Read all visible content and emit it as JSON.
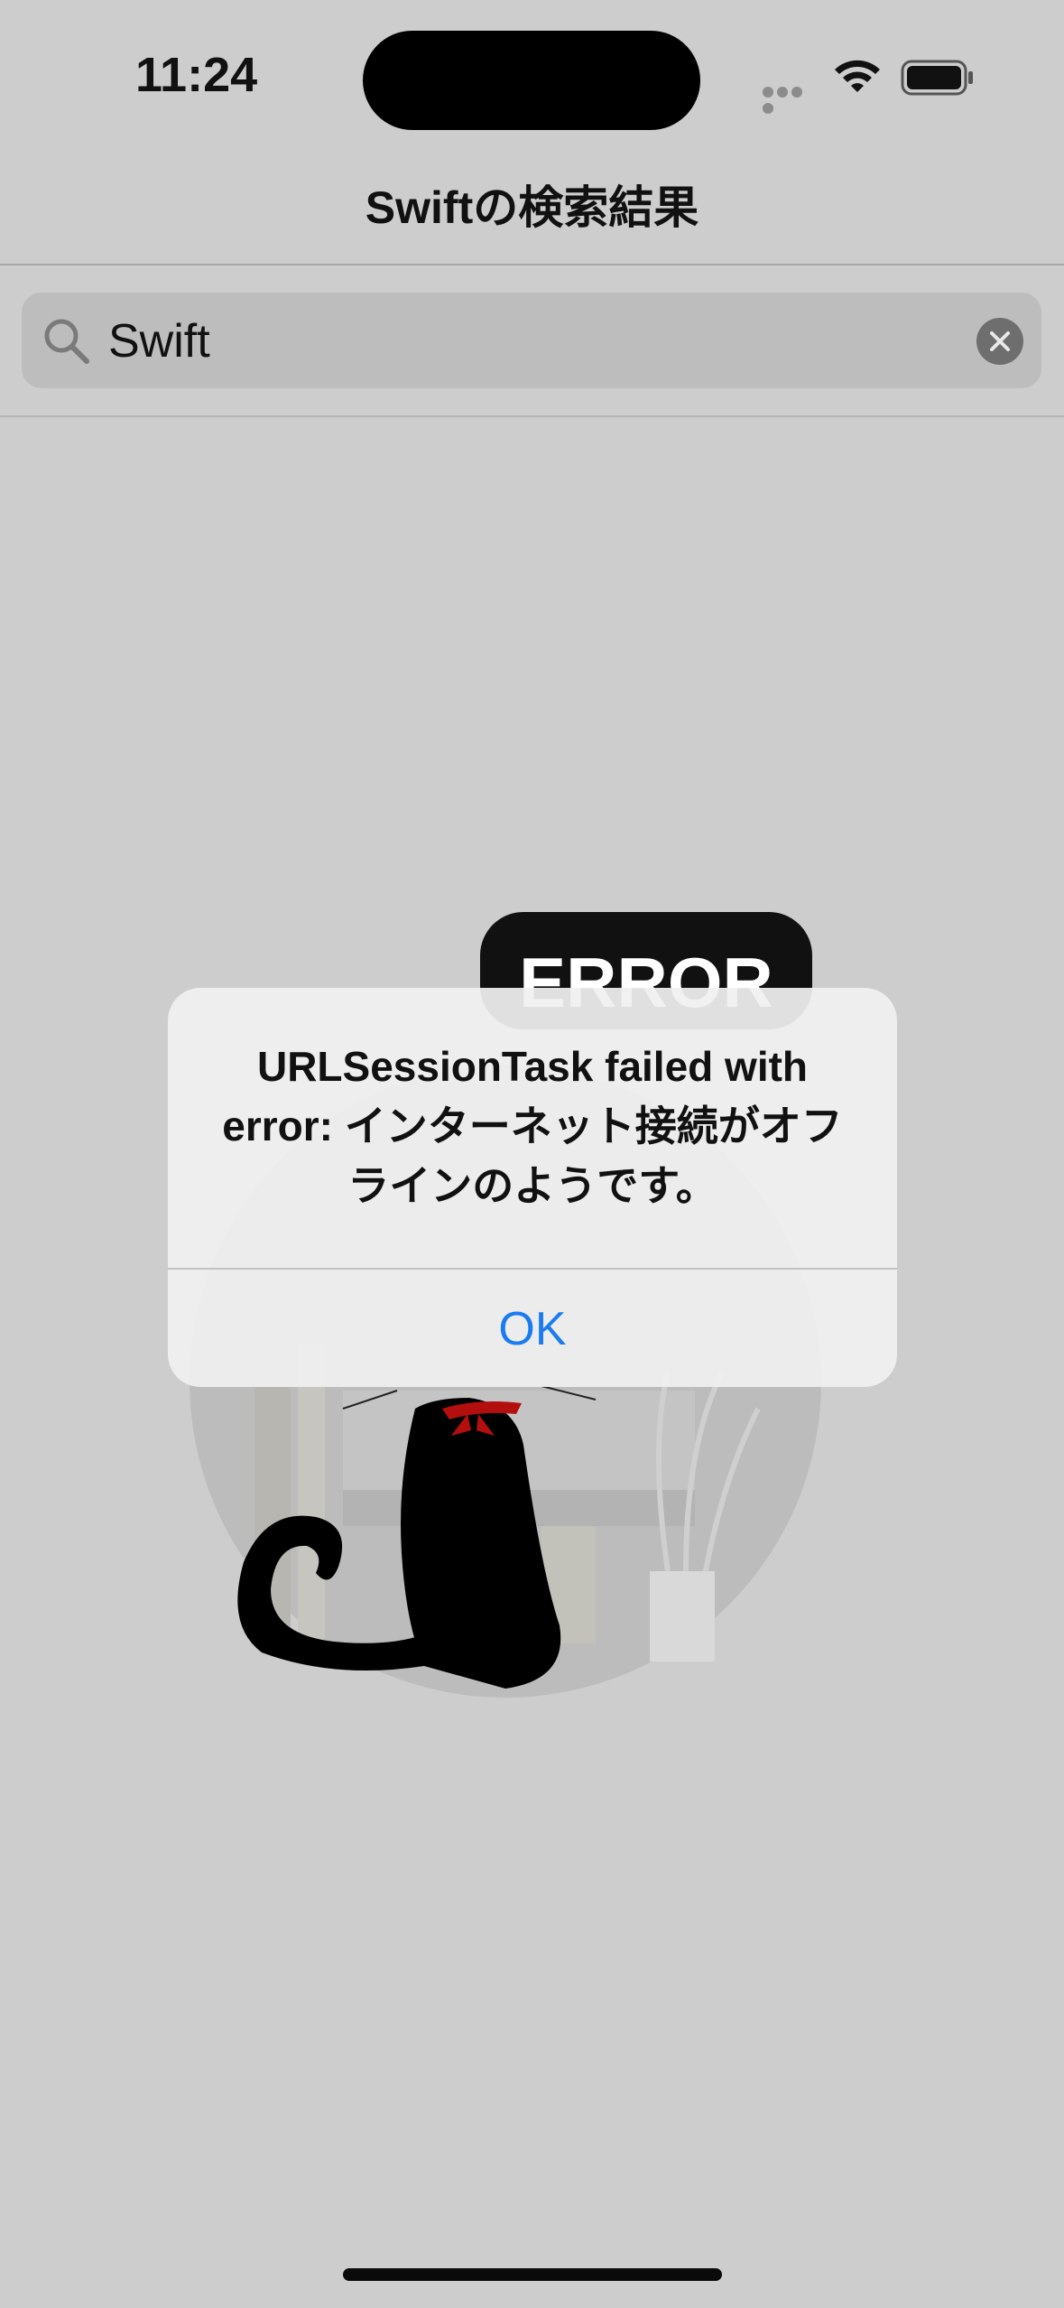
{
  "status_bar": {
    "time": "11:24",
    "icons": [
      "cellular-dots-icon",
      "wifi-icon",
      "battery-icon"
    ]
  },
  "nav": {
    "title": "Swiftの検索結果"
  },
  "search": {
    "value": "Swift",
    "icon": "search-icon",
    "clear_icon": "clear-icon"
  },
  "illustration": {
    "sign_text": "ERROR",
    "description_icon": "black-cat-icon"
  },
  "alert": {
    "message": "URLSessionTask failed with error: インターネット接続がオフラインのようです。",
    "ok_label": "OK"
  },
  "colors": {
    "background": "#cdcdcd",
    "accent": "#1a7cf0",
    "ribbon": "#b30f0f"
  }
}
